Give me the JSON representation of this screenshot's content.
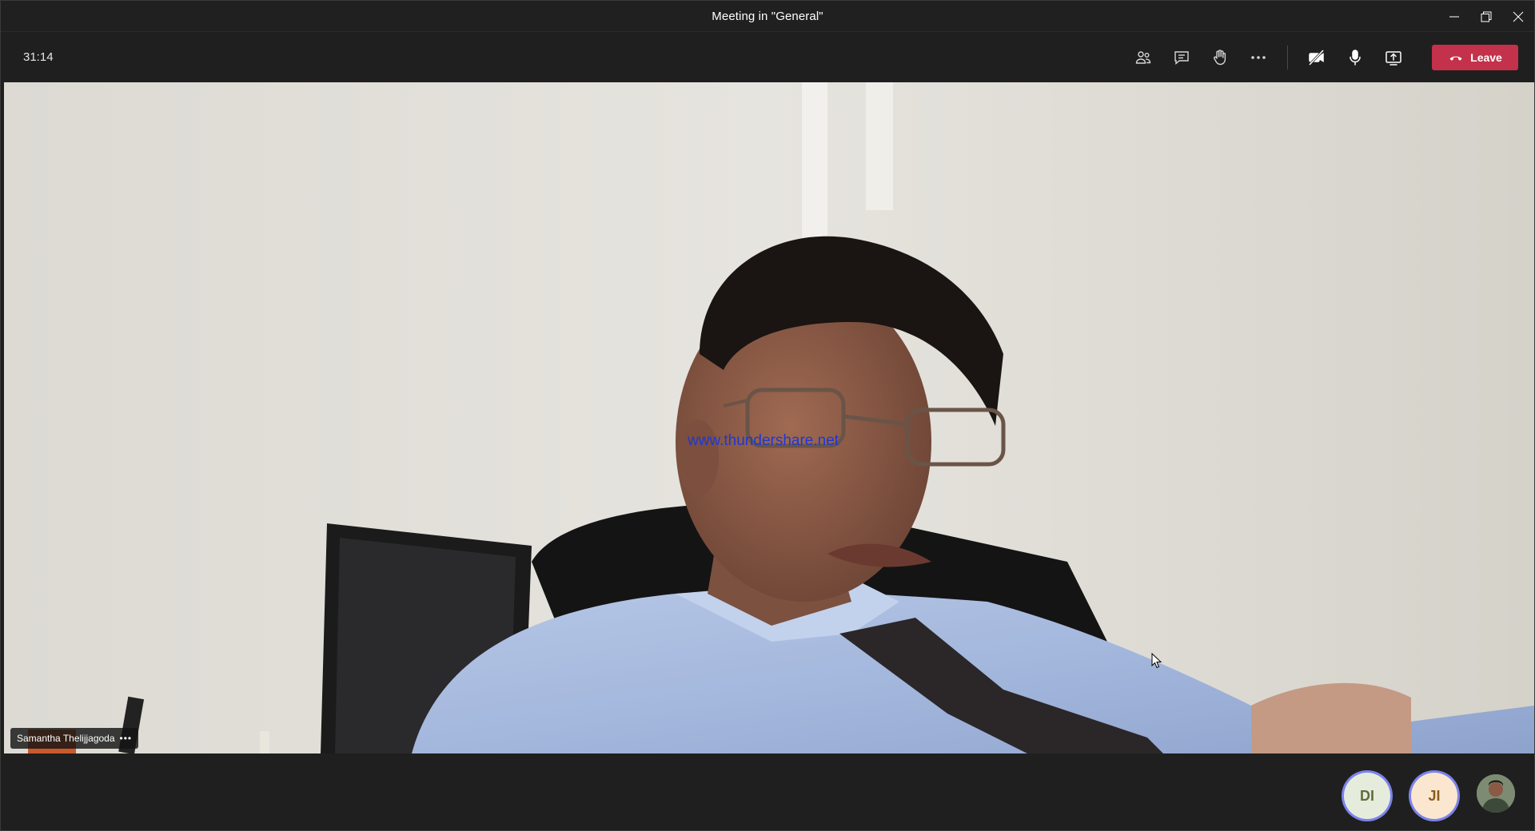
{
  "window": {
    "title": "Meeting in \"General\""
  },
  "toolbar": {
    "timer": "31:14",
    "icons": [
      "participants-icon",
      "chat-icon",
      "raise-hand-icon",
      "more-icon",
      "camera-off-icon",
      "microphone-icon",
      "share-tray-icon",
      "hangup-icon"
    ],
    "leave_label": "Leave",
    "leave_color": "#c4314b"
  },
  "stage": {
    "speaker_name": "Samantha Thelijjagoda",
    "more_label": "•••",
    "watermark": "www.thundershare.net"
  },
  "participants": [
    {
      "initials": "DI"
    },
    {
      "initials": "JI"
    }
  ],
  "colors": {
    "accent_ring": "#7b83eb",
    "watermark": "#1d38d6"
  }
}
